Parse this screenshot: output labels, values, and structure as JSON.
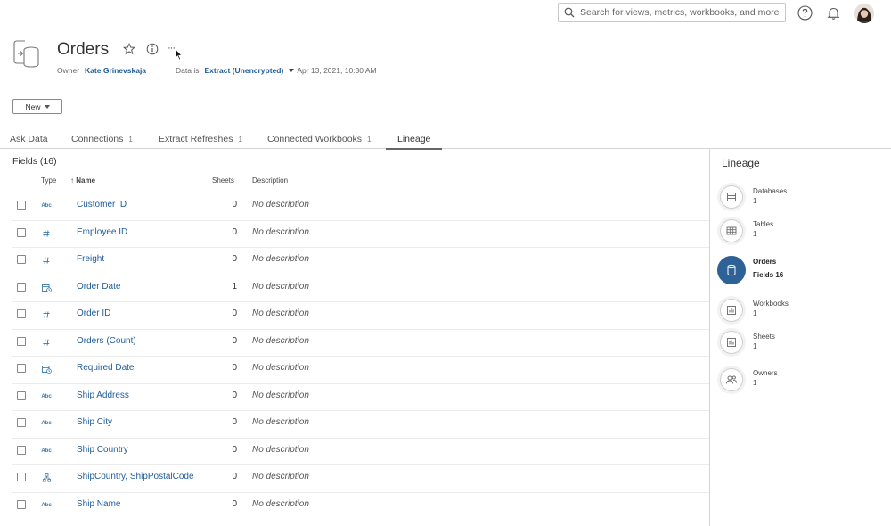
{
  "search": {
    "placeholder": "Search for views, metrics, workbooks, and more"
  },
  "header": {
    "title": "Orders",
    "owner_label": "Owner",
    "owner_name": "Kate Grinevskaja",
    "data_is_label": "Data is",
    "data_type": "Extract (Unencrypted)",
    "timestamp": "Apr 13, 2021, 10:30 AM",
    "more_label": "···"
  },
  "toolbar": {
    "new_label": "New"
  },
  "tabs": [
    {
      "label": "Ask Data",
      "count": ""
    },
    {
      "label": "Connections",
      "count": "1"
    },
    {
      "label": "Extract Refreshes",
      "count": "1"
    },
    {
      "label": "Connected Workbooks",
      "count": "1"
    },
    {
      "label": "Lineage",
      "count": ""
    }
  ],
  "fields": {
    "title": "Fields (16)",
    "columns": {
      "type": "Type",
      "name": "Name",
      "sort_arrow": "↑",
      "sheets": "Sheets",
      "description": "Description"
    },
    "rows": [
      {
        "type": "string",
        "type_text": "Abc",
        "name": "Customer ID",
        "sheets": "0",
        "description": "No description"
      },
      {
        "type": "number",
        "type_text": "#",
        "name": "Employee ID",
        "sheets": "0",
        "description": "No description"
      },
      {
        "type": "number",
        "type_text": "#",
        "name": "Freight",
        "sheets": "0",
        "description": "No description"
      },
      {
        "type": "date",
        "type_text": "",
        "name": "Order Date",
        "sheets": "1",
        "description": "No description"
      },
      {
        "type": "number",
        "type_text": "#",
        "name": "Order ID",
        "sheets": "0",
        "description": "No description"
      },
      {
        "type": "number",
        "type_text": "#",
        "name": "Orders (Count)",
        "sheets": "0",
        "description": "No description"
      },
      {
        "type": "date",
        "type_text": "",
        "name": "Required Date",
        "sheets": "0",
        "description": "No description"
      },
      {
        "type": "string",
        "type_text": "Abc",
        "name": "Ship Address",
        "sheets": "0",
        "description": "No description"
      },
      {
        "type": "string",
        "type_text": "Abc",
        "name": "Ship City",
        "sheets": "0",
        "description": "No description"
      },
      {
        "type": "string",
        "type_text": "Abc",
        "name": "Ship Country",
        "sheets": "0",
        "description": "No description"
      },
      {
        "type": "hierarchy",
        "type_text": "",
        "name": "ShipCountry, ShipPostalCode",
        "sheets": "0",
        "description": "No description"
      },
      {
        "type": "string",
        "type_text": "Abc",
        "name": "Ship Name",
        "sheets": "0",
        "description": "No description"
      }
    ]
  },
  "lineage": {
    "title": "Lineage",
    "items": [
      {
        "label": "Databases",
        "count": "1",
        "icon": "database-icon"
      },
      {
        "label": "Tables",
        "count": "1",
        "icon": "table-icon"
      },
      {
        "label": "Orders",
        "count": "Fields 16",
        "icon": "datasource-icon",
        "active": true
      },
      {
        "label": "Workbooks",
        "count": "1",
        "icon": "workbook-icon"
      },
      {
        "label": "Sheets",
        "count": "1",
        "icon": "sheet-icon"
      },
      {
        "label": "Owners",
        "count": "1",
        "icon": "owners-icon"
      }
    ]
  },
  "colors": {
    "link": "#1f5c99",
    "active_node": "#2e6196",
    "type_icon": "#3b78a8"
  }
}
